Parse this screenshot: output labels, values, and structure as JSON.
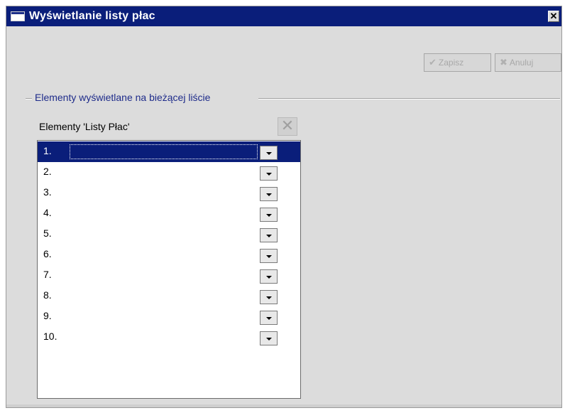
{
  "window": {
    "title": "Wyświetlanie listy płac",
    "close_label": "✕"
  },
  "toolbar": {
    "save_label": "Zapisz",
    "cancel_label": "Anuluj"
  },
  "group": {
    "label": "Elementy wyświetlane na bieżącej liście"
  },
  "list": {
    "caption": "Elementy 'Listy Płac'",
    "selected_index": 0,
    "rows": [
      {
        "num": "1.",
        "value": ""
      },
      {
        "num": "2.",
        "value": ""
      },
      {
        "num": "3.",
        "value": ""
      },
      {
        "num": "4.",
        "value": ""
      },
      {
        "num": "5.",
        "value": ""
      },
      {
        "num": "6.",
        "value": ""
      },
      {
        "num": "7.",
        "value": ""
      },
      {
        "num": "8.",
        "value": ""
      },
      {
        "num": "9.",
        "value": ""
      },
      {
        "num": "10.",
        "value": ""
      }
    ]
  },
  "colors": {
    "titlebar": "#0a1e7a",
    "group_label": "#1e2b8a",
    "selection": "#0a1e7a"
  },
  "icons": {
    "window": "window-icon",
    "save": "check-icon",
    "cancel": "x-icon",
    "clear": "clear-x-icon",
    "dropdown": "chevron-down-icon"
  }
}
